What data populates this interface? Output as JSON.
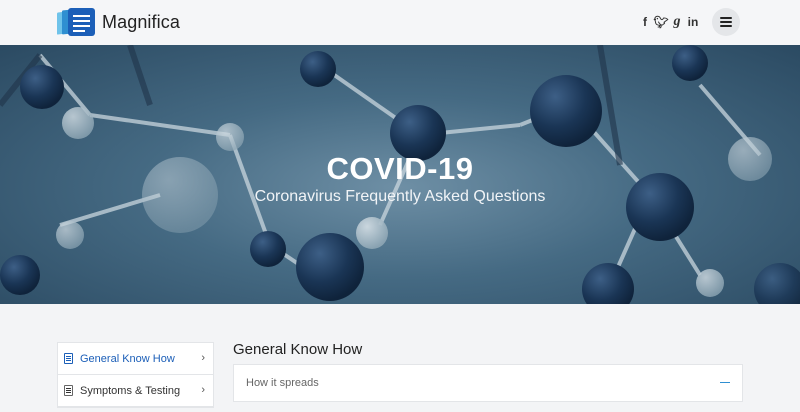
{
  "brand": {
    "name": "Magnifica"
  },
  "social": [
    "f",
    "t",
    "g",
    "in"
  ],
  "hero": {
    "title": "COVID-19",
    "subtitle": "Coronavirus Frequently Asked Questions"
  },
  "sidebar": {
    "items": [
      {
        "label": "General Know How",
        "active": true
      },
      {
        "label": "Symptoms & Testing",
        "active": false
      }
    ]
  },
  "main": {
    "section_title": "General Know How",
    "faq": [
      {
        "question": "How it spreads",
        "expanded": true
      }
    ]
  },
  "colors": {
    "accent": "#1c5fb8",
    "hero": "#456a83"
  }
}
